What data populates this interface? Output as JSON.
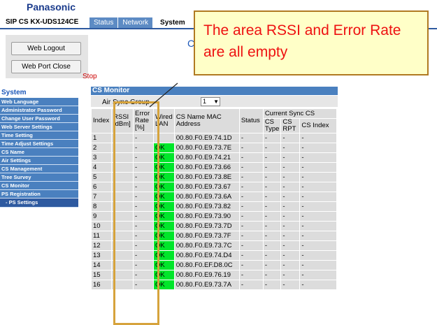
{
  "brand": "Panasonic",
  "model": "SIP CS KX-UDS124CE",
  "tabs": [
    {
      "label": "Status",
      "active": false
    },
    {
      "label": "Network",
      "active": false
    },
    {
      "label": "System",
      "active": true
    }
  ],
  "buttons": {
    "logout": "Web Logout",
    "port_close": "Web Port Close"
  },
  "stop_text": "Stop",
  "c_letter": "C",
  "sidebar": {
    "title": "System",
    "items": [
      {
        "label": "Web Language"
      },
      {
        "label": "Administrator Password"
      },
      {
        "label": "Change User Password"
      },
      {
        "label": "Web Server Settings"
      },
      {
        "label": "Time Setting"
      },
      {
        "label": "Time Adjust Settings"
      },
      {
        "label": "CS Name"
      },
      {
        "label": "Air Settings"
      },
      {
        "label": "CS Management"
      },
      {
        "label": "Tree Survey"
      },
      {
        "label": "CS Monitor"
      },
      {
        "label": "PS Registration"
      },
      {
        "label": "- PS Settings",
        "sub": true
      }
    ]
  },
  "monitor": {
    "title": "CS Monitor",
    "air_sync_label": "Air Sync Group",
    "air_sync_value": "1",
    "headers": {
      "index": "Index",
      "rssi": "RSSI [dBm]",
      "error_rate": "Error Rate [%]",
      "wired_lan": "Wired LAN",
      "cs_name_mac": "CS Name MAC Address",
      "status": "Status",
      "current_sync_cs": "Current Sync CS",
      "cs_type": "CS Type",
      "cs_rpt": "CS RPT",
      "cs_index": "CS Index"
    },
    "rows": [
      {
        "index": "1",
        "rssi": "-",
        "err": "-",
        "wired": "",
        "mac": "00.80.F0.E9.74.1D",
        "status": "-",
        "cstype": "-",
        "csrpt": "-",
        "csindex": "-"
      },
      {
        "index": "2",
        "rssi": "-",
        "err": "-",
        "wired": "OK",
        "mac": "00.80.F0.E9.73.7E",
        "status": "-",
        "cstype": "-",
        "csrpt": "-",
        "csindex": "-"
      },
      {
        "index": "3",
        "rssi": "-",
        "err": "-",
        "wired": "OK",
        "mac": "00.80.F0.E9.74.21",
        "status": "-",
        "cstype": "-",
        "csrpt": "-",
        "csindex": "-"
      },
      {
        "index": "4",
        "rssi": "-",
        "err": "-",
        "wired": "OK",
        "mac": "00.80.F0.E9.73.66",
        "status": "-",
        "cstype": "-",
        "csrpt": "-",
        "csindex": "-"
      },
      {
        "index": "5",
        "rssi": "-",
        "err": "-",
        "wired": "OK",
        "mac": "00.80.F0.E9.73.8E",
        "status": "-",
        "cstype": "-",
        "csrpt": "-",
        "csindex": "-"
      },
      {
        "index": "6",
        "rssi": "-",
        "err": "-",
        "wired": "OK",
        "mac": "00.80.F0.E9.73.67",
        "status": "-",
        "cstype": "-",
        "csrpt": "-",
        "csindex": "-"
      },
      {
        "index": "7",
        "rssi": "-",
        "err": "-",
        "wired": "OK",
        "mac": "00.80.F0.E9.73.6A",
        "status": "-",
        "cstype": "-",
        "csrpt": "-",
        "csindex": "-"
      },
      {
        "index": "8",
        "rssi": "-",
        "err": "-",
        "wired": "OK",
        "mac": "00.80.F0.E9.73.82",
        "status": "-",
        "cstype": "-",
        "csrpt": "-",
        "csindex": "-"
      },
      {
        "index": "9",
        "rssi": "-",
        "err": "-",
        "wired": "OK",
        "mac": "00.80.F0.E9.73.90",
        "status": "-",
        "cstype": "-",
        "csrpt": "-",
        "csindex": "-"
      },
      {
        "index": "10",
        "rssi": "-",
        "err": "-",
        "wired": "OK",
        "mac": "00.80.F0.E9.73.7D",
        "status": "-",
        "cstype": "-",
        "csrpt": "-",
        "csindex": "-"
      },
      {
        "index": "11",
        "rssi": "-",
        "err": "-",
        "wired": "OK",
        "mac": "00.80.F0.E9.73.7F",
        "status": "-",
        "cstype": "-",
        "csrpt": "-",
        "csindex": "-"
      },
      {
        "index": "12",
        "rssi": "-",
        "err": "-",
        "wired": "OK",
        "mac": "00.80.F0.E9.73.7C",
        "status": "-",
        "cstype": "-",
        "csrpt": "-",
        "csindex": "-"
      },
      {
        "index": "13",
        "rssi": "-",
        "err": "-",
        "wired": "OK",
        "mac": "00.80.F0.E9.74.D4",
        "status": "-",
        "cstype": "-",
        "csrpt": "-",
        "csindex": "-"
      },
      {
        "index": "14",
        "rssi": "-",
        "err": "-",
        "wired": "OK",
        "mac": "00.80.F0.EF.D8.0C",
        "status": "-",
        "cstype": "-",
        "csrpt": "-",
        "csindex": "-"
      },
      {
        "index": "15",
        "rssi": "-",
        "err": "-",
        "wired": "OK",
        "mac": "00.80.F0.E9.76.19",
        "status": "-",
        "cstype": "-",
        "csrpt": "-",
        "csindex": "-"
      },
      {
        "index": "16",
        "rssi": "-",
        "err": "-",
        "wired": "OK",
        "mac": "00.80.F0.E9.73.7A",
        "status": "-",
        "cstype": "-",
        "csrpt": "-",
        "csindex": "-"
      }
    ]
  },
  "callout": {
    "text": "The area RSSI and Error Rate are all empty"
  },
  "colors": {
    "tab_blue": "#5d8bc4",
    "menu_blue": "#4a80bf",
    "ok_green": "#00e62a",
    "callout_bg": "#ffffc8",
    "callout_text": "#ee1111",
    "highlight_border": "#d6a33c"
  }
}
